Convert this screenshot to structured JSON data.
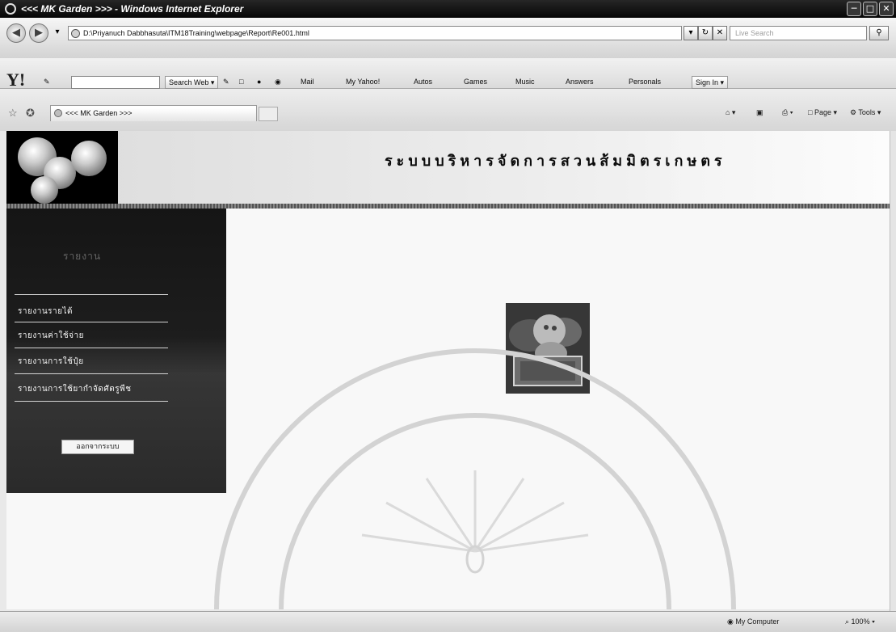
{
  "window": {
    "title": "<<< MK Garden >>> - Windows Internet Explorer",
    "minimize_icon": "minimize-icon",
    "maximize_icon": "maximize-icon",
    "close_icon": "close-icon"
  },
  "addressbar": {
    "url": "D:\\Priyanuch Dabbhasuta\\ITM18Training\\webpage\\Report\\Re001.html",
    "search_placeholder": "Live Search"
  },
  "toolbar": {
    "logo": "Y!",
    "search_web_label": "Search Web",
    "links": [
      "Mail",
      "My Yahoo!",
      "Autos",
      "Games",
      "Music",
      "Answers",
      "Personals"
    ],
    "sign_in_label": "Sign In"
  },
  "tabs": {
    "active_tab": "<<< MK Garden >>>"
  },
  "commandbar": {
    "page_label": "Page",
    "tools_label": "Tools"
  },
  "page": {
    "banner_title": "ระบบบริหารจัดการสวนส้มมิตรเกษตร",
    "sidebar_heading": "รายงาน",
    "menu_items": [
      "รายงานรายได้",
      "รายงานค่าใช้จ่าย",
      "รายงานการใช้ปุ๋ย",
      "รายงานการใช้ยากำจัดศัตรูพืช"
    ],
    "logout_label": "ออกจากระบบ"
  },
  "statusbar": {
    "zone": "My Computer",
    "zoom": "100%"
  },
  "colors": {
    "sidebar": "#222222",
    "banner": "#e0e0e0",
    "content_bg": "#f2f2f2"
  }
}
